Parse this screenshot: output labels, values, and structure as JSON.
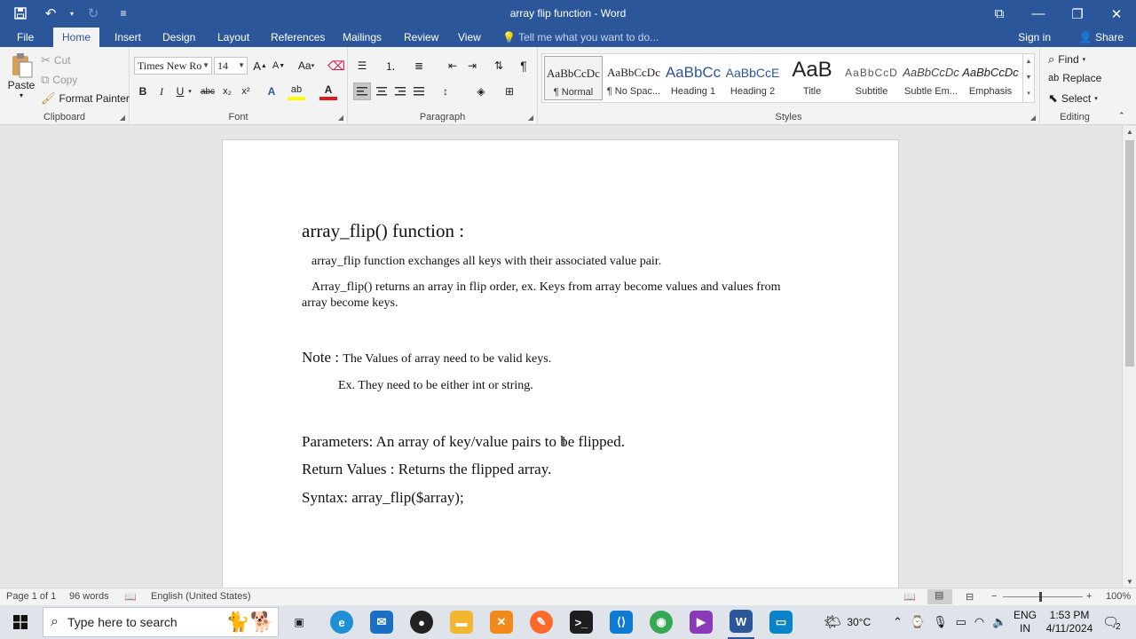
{
  "titlebar": {
    "title": "array flip function - Word",
    "save_icon": "💾",
    "undo_icon": "↶",
    "redo_icon": "↻",
    "customize_icon": "≡",
    "restore_icon": "⧉",
    "maximize_icon": "❐",
    "close_icon": "✕"
  },
  "tabs": [
    "File",
    "Home",
    "Insert",
    "Design",
    "Layout",
    "References",
    "Mailings",
    "Review",
    "View"
  ],
  "tell_me": "Tell me what you want to do...",
  "sign_in": "Sign in",
  "share": "Share",
  "clipboard": {
    "label": "Clipboard",
    "paste": "Paste",
    "cut": "Cut",
    "copy": "Copy",
    "format_painter": "Format Painter"
  },
  "font": {
    "label": "Font",
    "font_name": "Times New Ro",
    "font_size": "14",
    "grow": "A",
    "shrink": "A",
    "change_case": "Aa",
    "bold": "B",
    "italic": "I",
    "underline": "U",
    "strikethrough": "abc",
    "subscript": "x₂",
    "superscript": "x²",
    "text_effects": "A",
    "highlight": "ab",
    "font_color": "A"
  },
  "paragraph": {
    "label": "Paragraph",
    "pilcrow": "¶"
  },
  "styles": {
    "label": "Styles",
    "items": [
      {
        "preview": "AaBbCcDc",
        "name": "¶ Normal"
      },
      {
        "preview": "AaBbCcDc",
        "name": "¶ No Spac..."
      },
      {
        "preview": "AaBbCc",
        "name": "Heading 1"
      },
      {
        "preview": "AaBbCcE",
        "name": "Heading 2"
      },
      {
        "preview": "AaB",
        "name": "Title"
      },
      {
        "preview": "AaBbCcD",
        "name": "Subtitle"
      },
      {
        "preview": "AaBbCcDc",
        "name": "Subtle Em..."
      },
      {
        "preview": "AaBbCcDc",
        "name": "Emphasis"
      }
    ]
  },
  "editing": {
    "label": "Editing",
    "find": "Find",
    "replace": "Replace",
    "select": "Select"
  },
  "document": {
    "heading": "array_flip() function :",
    "line1": "array_flip function exchanges all keys with their associated value pair.",
    "line2a": "Array_flip() returns an array in flip order, ex. Keys from array become values and values from",
    "line2b": "array become keys.",
    "note_label": "Note : ",
    "note_text": "The Values of array need to be valid keys.",
    "note_ex": "Ex. They need to be either int or string.",
    "parameters": "Parameters: An array of key/value pairs to be flipped.",
    "return_values": "Return Values : Returns the flipped array.",
    "syntax": "Syntax: array_flip($array);"
  },
  "status": {
    "page": "Page 1 of 1",
    "words": "96 words",
    "language": "English (United States)",
    "zoom": "100%"
  },
  "taskbar": {
    "search_placeholder": "Type here to search",
    "weather": "30°C",
    "lang1": "ENG",
    "lang2": "IN",
    "time": "1:53 PM",
    "date": "4/11/2024",
    "notifications": "2"
  },
  "colors": {
    "word_blue": "#2b579a",
    "ribbon_bg": "#f3f3f3",
    "canvas_bg": "#e6e6e6",
    "heading_blue": "#2f5496"
  }
}
